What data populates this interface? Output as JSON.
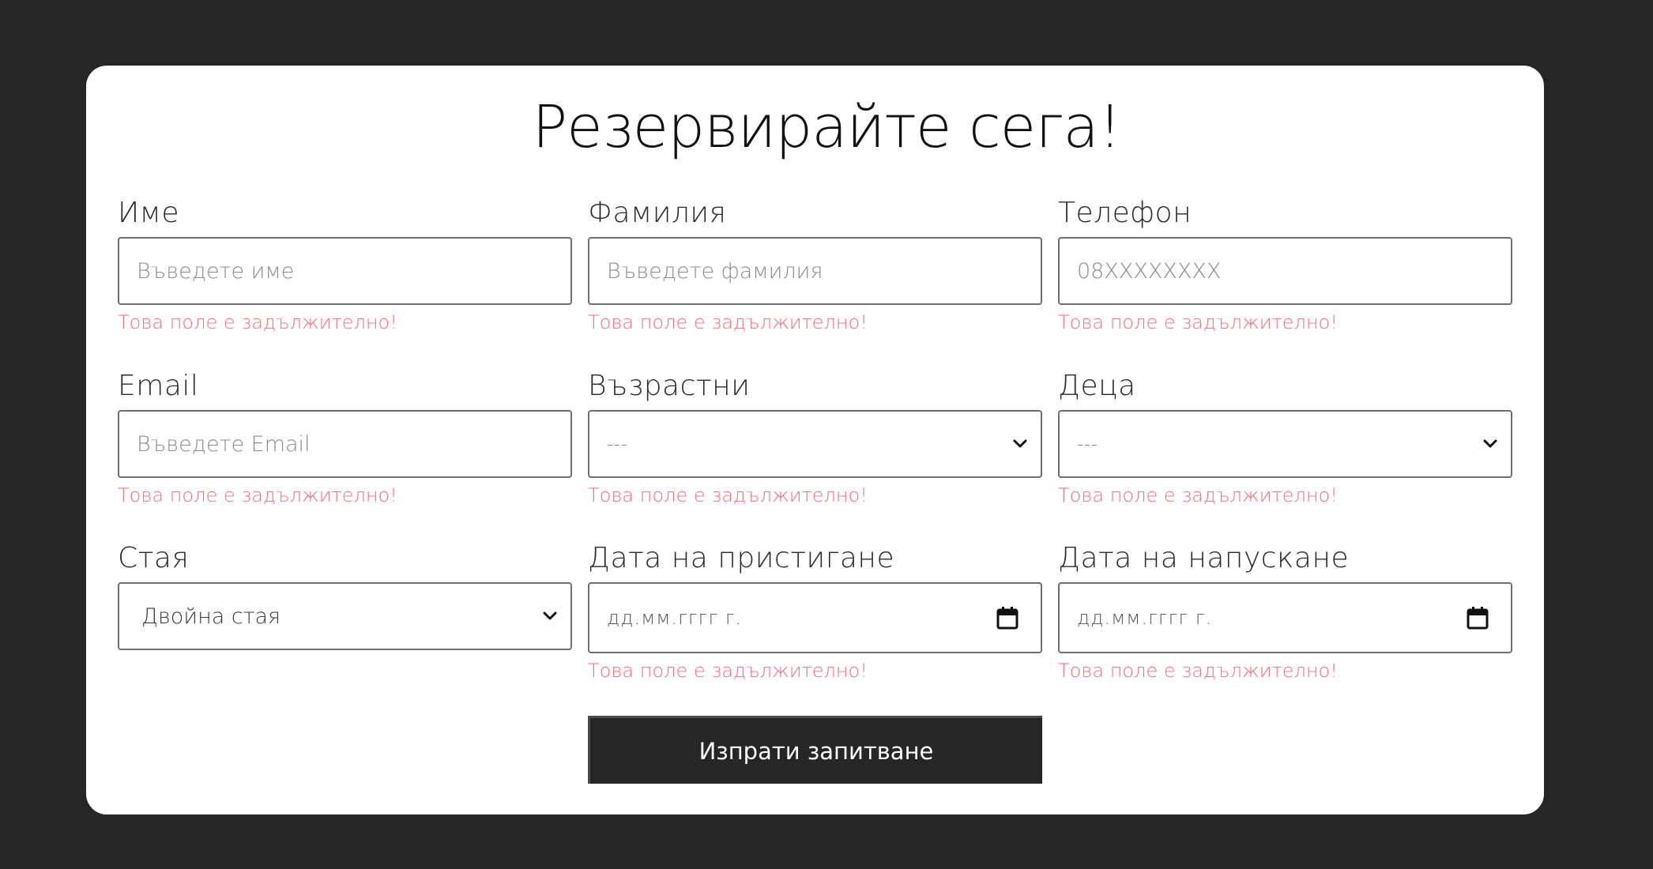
{
  "form": {
    "title": "Резервирайте сега!",
    "error_required": "Това поле е задължително!",
    "submit_label": "Изпрати запитване",
    "fields": {
      "first_name": {
        "label": "Име",
        "placeholder": "Въведете име",
        "value": ""
      },
      "last_name": {
        "label": "Фамилия",
        "placeholder": "Въведете фамилия",
        "value": ""
      },
      "phone": {
        "label": "Телефон",
        "placeholder": "08XXXXXXXX",
        "value": ""
      },
      "email": {
        "label": "Email",
        "placeholder": "Въведете Email",
        "value": ""
      },
      "adults": {
        "label": "Възрастни",
        "selected": "---"
      },
      "children": {
        "label": "Деца",
        "selected": "---"
      },
      "room": {
        "label": "Стая",
        "selected": "Двойна стая"
      },
      "arrival": {
        "label": "Дата на пристигане",
        "value": "дд.мм.гггг г."
      },
      "departure": {
        "label": "Дата на напускане",
        "value": "дд.мм.гггг г."
      }
    }
  },
  "icons": {
    "select": "chevron-down-icon",
    "date": "calendar-icon"
  },
  "colors": {
    "page_background": "#262626",
    "card_background": "#ffffff",
    "error": "#f46d7e",
    "button_background": "#262626",
    "button_text": "#ffffff"
  }
}
